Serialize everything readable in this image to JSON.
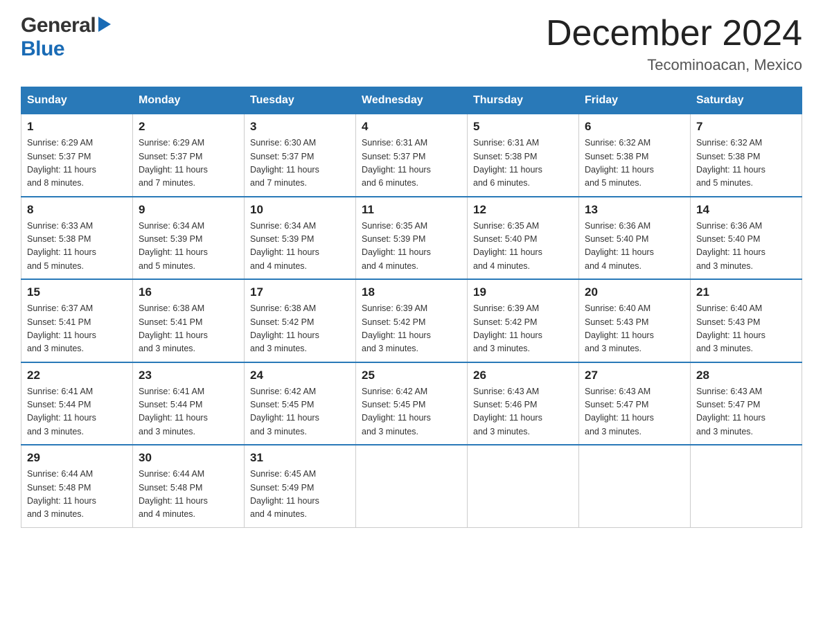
{
  "header": {
    "logo_general": "General",
    "logo_blue": "Blue",
    "title": "December 2024",
    "subtitle": "Tecominoacan, Mexico"
  },
  "days_of_week": [
    "Sunday",
    "Monday",
    "Tuesday",
    "Wednesday",
    "Thursday",
    "Friday",
    "Saturday"
  ],
  "weeks": [
    [
      {
        "day": "1",
        "sunrise": "6:29 AM",
        "sunset": "5:37 PM",
        "daylight": "11 hours and 8 minutes."
      },
      {
        "day": "2",
        "sunrise": "6:29 AM",
        "sunset": "5:37 PM",
        "daylight": "11 hours and 7 minutes."
      },
      {
        "day": "3",
        "sunrise": "6:30 AM",
        "sunset": "5:37 PM",
        "daylight": "11 hours and 7 minutes."
      },
      {
        "day": "4",
        "sunrise": "6:31 AM",
        "sunset": "5:37 PM",
        "daylight": "11 hours and 6 minutes."
      },
      {
        "day": "5",
        "sunrise": "6:31 AM",
        "sunset": "5:38 PM",
        "daylight": "11 hours and 6 minutes."
      },
      {
        "day": "6",
        "sunrise": "6:32 AM",
        "sunset": "5:38 PM",
        "daylight": "11 hours and 5 minutes."
      },
      {
        "day": "7",
        "sunrise": "6:32 AM",
        "sunset": "5:38 PM",
        "daylight": "11 hours and 5 minutes."
      }
    ],
    [
      {
        "day": "8",
        "sunrise": "6:33 AM",
        "sunset": "5:38 PM",
        "daylight": "11 hours and 5 minutes."
      },
      {
        "day": "9",
        "sunrise": "6:34 AM",
        "sunset": "5:39 PM",
        "daylight": "11 hours and 5 minutes."
      },
      {
        "day": "10",
        "sunrise": "6:34 AM",
        "sunset": "5:39 PM",
        "daylight": "11 hours and 4 minutes."
      },
      {
        "day": "11",
        "sunrise": "6:35 AM",
        "sunset": "5:39 PM",
        "daylight": "11 hours and 4 minutes."
      },
      {
        "day": "12",
        "sunrise": "6:35 AM",
        "sunset": "5:40 PM",
        "daylight": "11 hours and 4 minutes."
      },
      {
        "day": "13",
        "sunrise": "6:36 AM",
        "sunset": "5:40 PM",
        "daylight": "11 hours and 4 minutes."
      },
      {
        "day": "14",
        "sunrise": "6:36 AM",
        "sunset": "5:40 PM",
        "daylight": "11 hours and 3 minutes."
      }
    ],
    [
      {
        "day": "15",
        "sunrise": "6:37 AM",
        "sunset": "5:41 PM",
        "daylight": "11 hours and 3 minutes."
      },
      {
        "day": "16",
        "sunrise": "6:38 AM",
        "sunset": "5:41 PM",
        "daylight": "11 hours and 3 minutes."
      },
      {
        "day": "17",
        "sunrise": "6:38 AM",
        "sunset": "5:42 PM",
        "daylight": "11 hours and 3 minutes."
      },
      {
        "day": "18",
        "sunrise": "6:39 AM",
        "sunset": "5:42 PM",
        "daylight": "11 hours and 3 minutes."
      },
      {
        "day": "19",
        "sunrise": "6:39 AM",
        "sunset": "5:42 PM",
        "daylight": "11 hours and 3 minutes."
      },
      {
        "day": "20",
        "sunrise": "6:40 AM",
        "sunset": "5:43 PM",
        "daylight": "11 hours and 3 minutes."
      },
      {
        "day": "21",
        "sunrise": "6:40 AM",
        "sunset": "5:43 PM",
        "daylight": "11 hours and 3 minutes."
      }
    ],
    [
      {
        "day": "22",
        "sunrise": "6:41 AM",
        "sunset": "5:44 PM",
        "daylight": "11 hours and 3 minutes."
      },
      {
        "day": "23",
        "sunrise": "6:41 AM",
        "sunset": "5:44 PM",
        "daylight": "11 hours and 3 minutes."
      },
      {
        "day": "24",
        "sunrise": "6:42 AM",
        "sunset": "5:45 PM",
        "daylight": "11 hours and 3 minutes."
      },
      {
        "day": "25",
        "sunrise": "6:42 AM",
        "sunset": "5:45 PM",
        "daylight": "11 hours and 3 minutes."
      },
      {
        "day": "26",
        "sunrise": "6:43 AM",
        "sunset": "5:46 PM",
        "daylight": "11 hours and 3 minutes."
      },
      {
        "day": "27",
        "sunrise": "6:43 AM",
        "sunset": "5:47 PM",
        "daylight": "11 hours and 3 minutes."
      },
      {
        "day": "28",
        "sunrise": "6:43 AM",
        "sunset": "5:47 PM",
        "daylight": "11 hours and 3 minutes."
      }
    ],
    [
      {
        "day": "29",
        "sunrise": "6:44 AM",
        "sunset": "5:48 PM",
        "daylight": "11 hours and 3 minutes."
      },
      {
        "day": "30",
        "sunrise": "6:44 AM",
        "sunset": "5:48 PM",
        "daylight": "11 hours and 4 minutes."
      },
      {
        "day": "31",
        "sunrise": "6:45 AM",
        "sunset": "5:49 PM",
        "daylight": "11 hours and 4 minutes."
      },
      null,
      null,
      null,
      null
    ]
  ],
  "labels": {
    "sunrise": "Sunrise:",
    "sunset": "Sunset:",
    "daylight": "Daylight:"
  }
}
